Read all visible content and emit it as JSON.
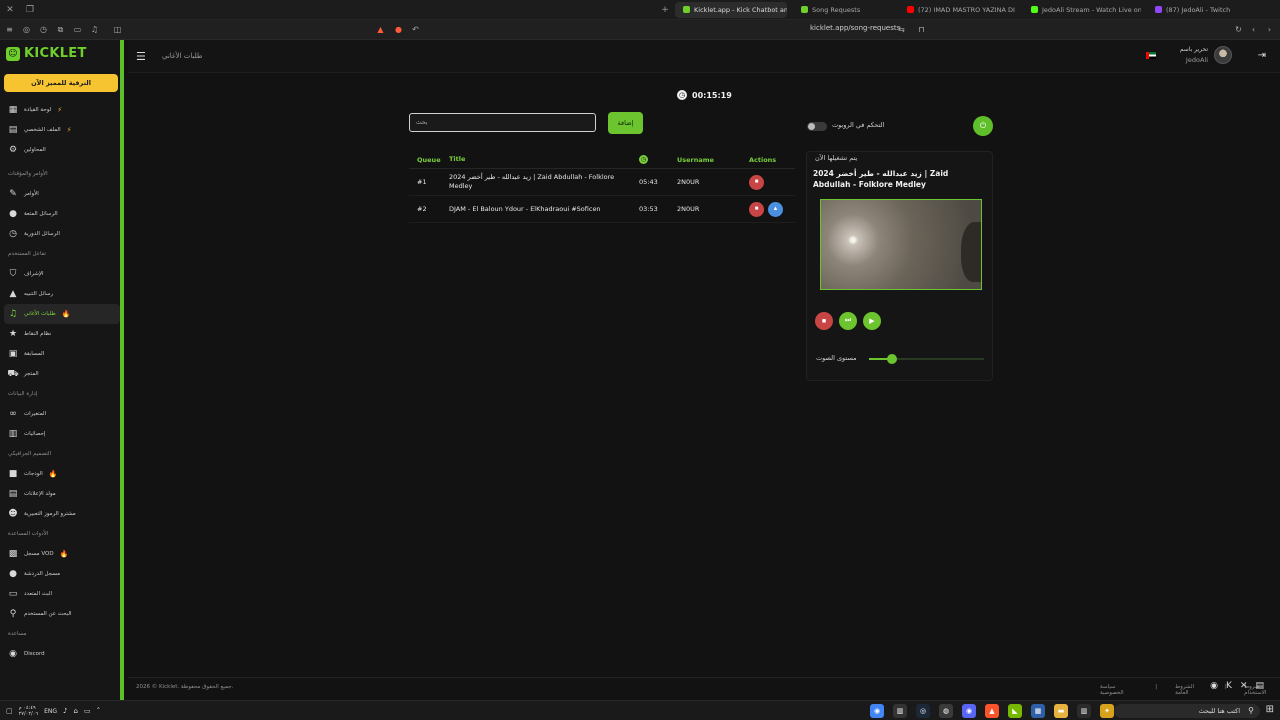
{
  "browser": {
    "tabs": [
      {
        "label": "Kicklet.app - Kick Chatbot and C",
        "active": true,
        "color": "#6fd02c"
      },
      {
        "label": "Song Requests",
        "active": false,
        "color": "#6fd02c"
      },
      {
        "label": "(72) IMAD MASTRO YAZINA DI",
        "active": false,
        "color": "#ff0000"
      },
      {
        "label": "JedoAli Stream - Watch Live on",
        "active": false,
        "color": "#53fc18"
      },
      {
        "label": "(87) JedoAli - Twitch",
        "active": false,
        "color": "#9146ff"
      }
    ],
    "url": "kicklet.app/song-requests"
  },
  "sidebar": {
    "logo": "KICKLET",
    "upgrade_label": "الترقية للمميز الآن",
    "sections": [
      {
        "title": "",
        "items": [
          {
            "label": "لوحة القيادة",
            "icon": "dashboard-icon",
            "glyph": "▦",
            "badge": "⚡"
          },
          {
            "label": "الملف الشخصي",
            "icon": "profile-icon",
            "glyph": "▤",
            "badge": "⚡"
          },
          {
            "label": "المحاولين",
            "icon": "moderators-icon",
            "glyph": "⚙",
            "badge": ""
          }
        ]
      },
      {
        "title": "الأوامر والمؤقتات",
        "items": [
          {
            "label": "الأوامر",
            "icon": "commands-icon",
            "glyph": "✎",
            "badge": ""
          },
          {
            "label": "الرسائل المتعة",
            "icon": "messages-icon",
            "glyph": "●",
            "badge": ""
          },
          {
            "label": "الرسائل الدورية",
            "icon": "timers-icon",
            "glyph": "◷",
            "badge": ""
          }
        ]
      },
      {
        "title": "تفاعل المستخدم",
        "items": [
          {
            "label": "الإشراف",
            "icon": "shield-icon",
            "glyph": "⛉",
            "badge": ""
          },
          {
            "label": "رسائل التنبيه",
            "icon": "alert-icon",
            "glyph": "▲",
            "badge": ""
          },
          {
            "label": "طلبات الأغاني",
            "icon": "music-icon",
            "glyph": "♫",
            "badge": "🔥",
            "active": true
          },
          {
            "label": "نظام النقاط",
            "icon": "star-icon",
            "glyph": "★",
            "badge": ""
          },
          {
            "label": "المسابقة",
            "icon": "gift-icon",
            "glyph": "▣",
            "badge": ""
          },
          {
            "label": "المتجر",
            "icon": "cart-icon",
            "glyph": "⛟",
            "badge": ""
          }
        ]
      },
      {
        "title": "إدارة البيانات",
        "items": [
          {
            "label": "المتغيرات",
            "icon": "link-icon",
            "glyph": "∞",
            "badge": ""
          },
          {
            "label": "إحصائيات",
            "icon": "stats-icon",
            "glyph": "▥",
            "badge": ""
          }
        ]
      },
      {
        "title": "التصميم الجرافيكي",
        "items": [
          {
            "label": "الودجات",
            "icon": "widgets-icon",
            "glyph": "■",
            "badge": "🔥"
          },
          {
            "label": "مولد الإعلانات",
            "icon": "ads-icon",
            "glyph": "▤",
            "badge": ""
          },
          {
            "label": "مشترو الرموز التعبيرية",
            "icon": "emoji-icon",
            "glyph": "☻",
            "badge": ""
          }
        ]
      },
      {
        "title": "الأدوات المساعدة",
        "items": [
          {
            "label": "مسجل VOD",
            "icon": "vod-icon",
            "glyph": "▩",
            "badge": "🔥"
          },
          {
            "label": "مسجل الدردشة",
            "icon": "chat-log-icon",
            "glyph": "●",
            "badge": ""
          },
          {
            "label": "البث المتعدد",
            "icon": "multistream-icon",
            "glyph": "▭",
            "badge": ""
          },
          {
            "label": "البحث عن المستخدم",
            "icon": "user-search-icon",
            "glyph": "⚲",
            "badge": ""
          }
        ]
      },
      {
        "title": "مساعدة",
        "items": [
          {
            "label": "Discord",
            "icon": "discord-icon",
            "glyph": "◉",
            "badge": ""
          }
        ]
      }
    ]
  },
  "header": {
    "breadcrumb": "طلبات الأغاني",
    "user_role": "تحرير باسم",
    "user_name": "JedoAli"
  },
  "main": {
    "timer": "00:15:19",
    "search_placeholder": "بحث",
    "add_label": "إضافة",
    "columns": {
      "queue": "Queue",
      "title": "Title",
      "username": "Username",
      "actions": "Actions"
    },
    "rows": [
      {
        "queue": "#1",
        "title": "2024 زيد عبدالله - طير أخضر | Zaid Abdullah - Folklore Medley",
        "duration": "05:43",
        "username": "2N0UR",
        "has_up": false
      },
      {
        "queue": "#2",
        "title": "DJAM - El Baloun Ydour - ElKhadraoui #Soficen",
        "duration": "03:53",
        "username": "2N0UR",
        "has_up": true
      }
    ],
    "bot_control_label": "التحكم في الروبوت",
    "bot_enabled": false,
    "now_playing_label": "يتم تشغيلها الآن",
    "now_playing_title": "2024 زيد عبدالله - طير أخضر | Zaid Abdullah - Folklore Medley",
    "volume_label": "مستوى الصوت",
    "volume": 0.2
  },
  "footer": {
    "copyright": "2026 © Kicklet. جميع الحقوق محفوظة.",
    "links": [
      "سياسة الخصوصية",
      "|",
      "الشروط العامة",
      "|",
      "شروط الاستخدام"
    ]
  },
  "taskbar": {
    "lang": "ENG",
    "time": "٠٤:٤٩ م",
    "date": "٢٧/٠٢/٠٦",
    "search_placeholder": "اكتب هنا للبحث"
  },
  "colors": {
    "accent": "#6cc42e",
    "danger": "#c84545",
    "info": "#4a8fe0",
    "upgrade": "#f6c431"
  }
}
